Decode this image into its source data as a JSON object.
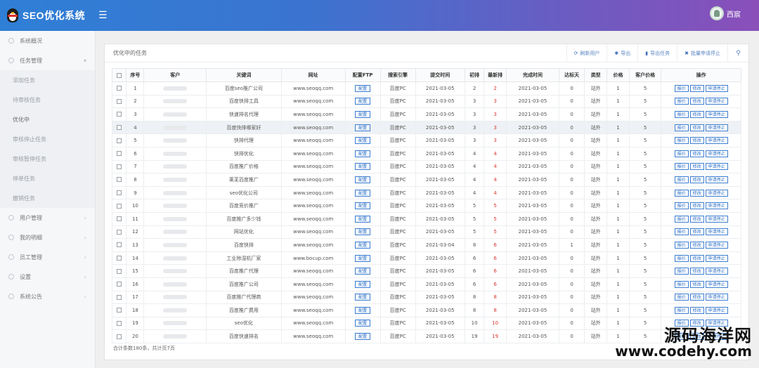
{
  "app": {
    "title": "SEO优化系统",
    "menu_icon": "hamburger-icon"
  },
  "user": {
    "name": "西宸"
  },
  "sidebar": {
    "items": [
      {
        "label": "系统概况",
        "icon": "dashboard-icon",
        "level": "top"
      },
      {
        "label": "任务管理",
        "icon": "task-icon",
        "level": "top",
        "expanded": true
      },
      {
        "label": "添加任务",
        "level": "sub"
      },
      {
        "label": "待审核任务",
        "level": "sub"
      },
      {
        "label": "优化中",
        "level": "sub",
        "active": true
      },
      {
        "label": "审核停止任务",
        "level": "sub"
      },
      {
        "label": "审核暂停任务",
        "level": "sub"
      },
      {
        "label": "停单任务",
        "level": "sub"
      },
      {
        "label": "撤销任务",
        "level": "sub"
      },
      {
        "label": "用户管理",
        "icon": "user-icon",
        "level": "top"
      },
      {
        "label": "我的明细",
        "icon": "detail-icon",
        "level": "top"
      },
      {
        "label": "员工管理",
        "icon": "staff-icon",
        "level": "top"
      },
      {
        "label": "设置",
        "icon": "settings-icon",
        "level": "top"
      },
      {
        "label": "系统公告",
        "icon": "notice-icon",
        "level": "top"
      }
    ]
  },
  "panel": {
    "title": "优化中的任务",
    "toolbar": [
      {
        "label": "刷新用户",
        "icon": "refresh-icon"
      },
      {
        "label": "导出",
        "icon": "export-icon"
      },
      {
        "label": "导出任务",
        "icon": "file-icon"
      },
      {
        "label": "批量申请停止",
        "icon": "close-icon"
      }
    ],
    "search_icon": "search-icon"
  },
  "table": {
    "headers": [
      "",
      "序号",
      "客户",
      "关键词",
      "网址",
      "配置FTP",
      "搜索引擎",
      "提交时间",
      "初排",
      "最新排",
      "完成时间",
      "达标天",
      "类型",
      "价格",
      "客户价格",
      "操作"
    ],
    "tag_label": "配置",
    "op_labels": [
      "报价",
      "修改",
      "申请停止"
    ],
    "rows": [
      {
        "no": "1",
        "keyword": "百度seo推广公司",
        "url": "www.seoqq.com",
        "engine": "百度PC",
        "submit": "2021-03-05",
        "init": "2",
        "latest": "2",
        "done": "2021-03-05",
        "days": "0",
        "type": "站外",
        "price": "1",
        "cprice": "5"
      },
      {
        "no": "2",
        "keyword": "百度快排工具",
        "url": "www.seoqq.com",
        "engine": "百度PC",
        "submit": "2021-03-05",
        "init": "3",
        "latest": "3",
        "done": "2021-03-05",
        "days": "0",
        "type": "站外",
        "price": "1",
        "cprice": "5"
      },
      {
        "no": "3",
        "keyword": "快速排名代理",
        "url": "www.seoqq.com",
        "engine": "百度PC",
        "submit": "2021-03-05",
        "init": "3",
        "latest": "3",
        "done": "2021-03-05",
        "days": "0",
        "type": "站外",
        "price": "1",
        "cprice": "5"
      },
      {
        "no": "4",
        "keyword": "百度快排哪家好",
        "url": "www.seoqq.com",
        "engine": "百度PC",
        "submit": "2021-03-05",
        "init": "3",
        "latest": "3",
        "done": "2021-03-05",
        "days": "0",
        "type": "站外",
        "price": "1",
        "cprice": "5",
        "hl": true
      },
      {
        "no": "5",
        "keyword": "快排代理",
        "url": "www.seoqq.com",
        "engine": "百度PC",
        "submit": "2021-03-05",
        "init": "3",
        "latest": "3",
        "done": "2021-03-05",
        "days": "0",
        "type": "站外",
        "price": "1",
        "cprice": "5"
      },
      {
        "no": "6",
        "keyword": "快排优化",
        "url": "www.seoqq.com",
        "engine": "百度PC",
        "submit": "2021-03-05",
        "init": "4",
        "latest": "4",
        "done": "2021-03-05",
        "days": "0",
        "type": "站外",
        "price": "1",
        "cprice": "5"
      },
      {
        "no": "7",
        "keyword": "百度推广价格",
        "url": "www.seoqq.com",
        "engine": "百度PC",
        "submit": "2021-03-05",
        "init": "4",
        "latest": "4",
        "done": "2021-03-05",
        "days": "0",
        "type": "站外",
        "price": "1",
        "cprice": "5"
      },
      {
        "no": "8",
        "keyword": "莱芜百度推广",
        "url": "www.seoqq.com",
        "engine": "百度PC",
        "submit": "2021-03-05",
        "init": "4",
        "latest": "4",
        "done": "2021-03-05",
        "days": "0",
        "type": "站外",
        "price": "1",
        "cprice": "5"
      },
      {
        "no": "9",
        "keyword": "seo优化公司",
        "url": "www.seoqq.com",
        "engine": "百度PC",
        "submit": "2021-03-05",
        "init": "4",
        "latest": "4",
        "done": "2021-03-05",
        "days": "0",
        "type": "站外",
        "price": "1",
        "cprice": "5"
      },
      {
        "no": "10",
        "keyword": "百度竞价推广",
        "url": "www.seoqq.com",
        "engine": "百度PC",
        "submit": "2021-03-05",
        "init": "5",
        "latest": "5",
        "done": "2021-03-05",
        "days": "0",
        "type": "站外",
        "price": "1",
        "cprice": "5"
      },
      {
        "no": "11",
        "keyword": "百度推广多少钱",
        "url": "www.seoqq.com",
        "engine": "百度PC",
        "submit": "2021-03-05",
        "init": "5",
        "latest": "5",
        "done": "2021-03-05",
        "days": "0",
        "type": "站外",
        "price": "1",
        "cprice": "5"
      },
      {
        "no": "12",
        "keyword": "网站优化",
        "url": "www.seoqq.com",
        "engine": "百度PC",
        "submit": "2021-03-05",
        "init": "5",
        "latest": "5",
        "done": "2021-03-05",
        "days": "0",
        "type": "站外",
        "price": "1",
        "cprice": "5"
      },
      {
        "no": "13",
        "keyword": "百度快排",
        "url": "www.seoqq.com",
        "engine": "百度PC",
        "submit": "2021-03-04",
        "init": "8",
        "latest": "6",
        "done": "2021-03-05",
        "days": "1",
        "type": "站外",
        "price": "1",
        "cprice": "5"
      },
      {
        "no": "14",
        "keyword": "工业除湿机厂家",
        "url": "www.bocup.com",
        "engine": "百度PC",
        "submit": "2021-03-05",
        "init": "6",
        "latest": "6",
        "done": "2021-03-05",
        "days": "0",
        "type": "站外",
        "price": "1",
        "cprice": "5"
      },
      {
        "no": "15",
        "keyword": "百度推广代理",
        "url": "www.seoqq.com",
        "engine": "百度PC",
        "submit": "2021-03-05",
        "init": "6",
        "latest": "6",
        "done": "2021-03-05",
        "days": "0",
        "type": "站外",
        "price": "1",
        "cprice": "5"
      },
      {
        "no": "16",
        "keyword": "百度推广公司",
        "url": "www.seoqq.com",
        "engine": "百度PC",
        "submit": "2021-03-05",
        "init": "6",
        "latest": "6",
        "done": "2021-03-05",
        "days": "0",
        "type": "站外",
        "price": "1",
        "cprice": "5"
      },
      {
        "no": "17",
        "keyword": "百度推广代理商",
        "url": "www.seoqq.com",
        "engine": "百度PC",
        "submit": "2021-03-05",
        "init": "8",
        "latest": "8",
        "done": "2021-03-05",
        "days": "0",
        "type": "站外",
        "price": "1",
        "cprice": "5"
      },
      {
        "no": "18",
        "keyword": "百度推广费用",
        "url": "www.seoqq.com",
        "engine": "百度PC",
        "submit": "2021-03-05",
        "init": "8",
        "latest": "8",
        "done": "2021-03-05",
        "days": "0",
        "type": "站外",
        "price": "1",
        "cprice": "5"
      },
      {
        "no": "19",
        "keyword": "seo优化",
        "url": "www.seoqq.com",
        "engine": "百度PC",
        "submit": "2021-03-05",
        "init": "10",
        "latest": "10",
        "done": "2021-03-05",
        "days": "0",
        "type": "站外",
        "price": "1",
        "cprice": "5"
      },
      {
        "no": "20",
        "keyword": "百度快速排名",
        "url": "www.seoqq.com",
        "engine": "百度PC",
        "submit": "2021-03-05",
        "init": "19",
        "latest": "19",
        "done": "2021-03-05",
        "days": "0",
        "type": "站外",
        "price": "1",
        "cprice": "5"
      }
    ]
  },
  "footer": {
    "info": "合计条数180条，共计页7页"
  },
  "watermark": {
    "line1": "源码海洋网",
    "line2": "www.codehy.com"
  },
  "colors": {
    "header_start": "#2f7fd6",
    "header_end": "#8a4fb9",
    "accent": "#2e6fc4",
    "rank_red": "#d8352d"
  }
}
